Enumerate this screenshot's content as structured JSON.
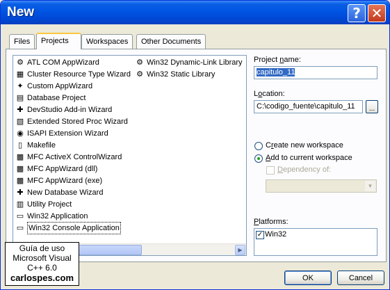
{
  "window": {
    "title": "New",
    "help_glyph": "?",
    "close_glyph": "✕"
  },
  "tabs": [
    {
      "label": "Files"
    },
    {
      "label": "Projects"
    },
    {
      "label": "Workspaces"
    },
    {
      "label": "Other Documents"
    }
  ],
  "active_tab": "Projects",
  "project_types": {
    "col1": [
      {
        "label": "ATL COM AppWizard",
        "icon": "atl-icon"
      },
      {
        "label": "Cluster Resource Type Wizard",
        "icon": "cluster-icon"
      },
      {
        "label": "Custom AppWizard",
        "icon": "custom-wizard-icon"
      },
      {
        "label": "Database Project",
        "icon": "database-icon"
      },
      {
        "label": "DevStudio Add-in Wizard",
        "icon": "addin-icon"
      },
      {
        "label": "Extended Stored Proc Wizard",
        "icon": "stored-proc-icon"
      },
      {
        "label": "ISAPI Extension Wizard",
        "icon": "isapi-icon"
      },
      {
        "label": "Makefile",
        "icon": "makefile-icon"
      },
      {
        "label": "MFC ActiveX ControlWizard",
        "icon": "activex-icon"
      },
      {
        "label": "MFC AppWizard (dll)",
        "icon": "mfc-dll-icon"
      },
      {
        "label": "MFC AppWizard (exe)",
        "icon": "mfc-exe-icon"
      },
      {
        "label": "New Database Wizard",
        "icon": "new-db-icon"
      },
      {
        "label": "Utility Project",
        "icon": "utility-icon"
      },
      {
        "label": "Win32 Application",
        "icon": "win32-app-icon"
      },
      {
        "label": "Win32 Console Application",
        "icon": "console-icon"
      }
    ],
    "col2": [
      {
        "label": "Win32 Dynamic-Link Library",
        "icon": "dll-icon"
      },
      {
        "label": "Win32 Static Library",
        "icon": "static-lib-icon"
      }
    ],
    "selected": "Win32 Console Application"
  },
  "project_name": {
    "label_pre": "Project ",
    "label_u": "n",
    "label_post": "ame:",
    "value": "capitulo_11"
  },
  "location": {
    "label_pre": "L",
    "label_u": "o",
    "label_post": "cation:",
    "value": "C:\\codigo_fuente\\capitulo_11",
    "browse_label": "..."
  },
  "workspace": {
    "create_pre": "C",
    "create_u": "r",
    "create_post": "eate new workspace",
    "add_pre": "",
    "add_u": "A",
    "add_post": "dd to current workspace",
    "selected": "add",
    "dependency_pre": "",
    "dependency_u": "D",
    "dependency_post": "ependency of:",
    "dependency_checked": false,
    "dependency_value": ""
  },
  "platforms": {
    "label_pre": "",
    "label_u": "P",
    "label_post": "latforms:",
    "items": [
      {
        "label": "Win32",
        "checked": true
      }
    ]
  },
  "buttons": {
    "ok": "OK",
    "cancel": "Cancel"
  },
  "watermark": {
    "line1": "Guía de uso",
    "line2": "Microsoft Visual",
    "line3": "C++ 6.0",
    "site": "carlospes.com"
  }
}
